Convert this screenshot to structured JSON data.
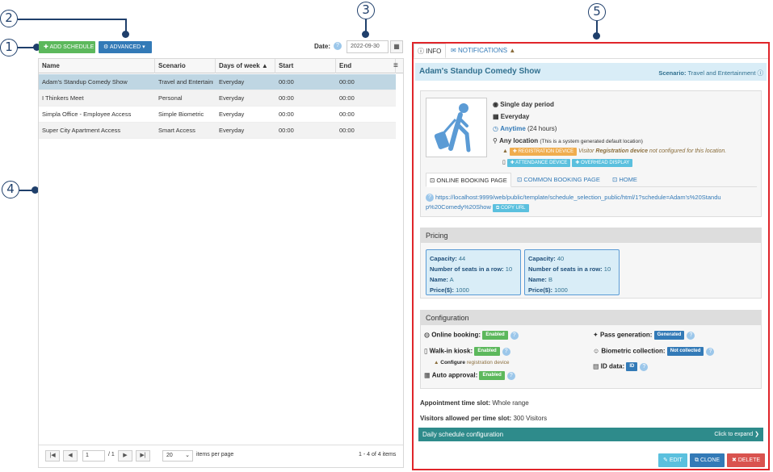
{
  "callouts": [
    "1",
    "2",
    "3",
    "4",
    "5"
  ],
  "toolbar": {
    "add_schedule": "ADD SCHEDULE",
    "advanced": "ADVANCED",
    "date_label": "Date:",
    "date_value": "2022-09-30"
  },
  "grid": {
    "columns": [
      "Name",
      "Scenario",
      "Days of week",
      "Start",
      "End"
    ],
    "rows": [
      {
        "name": "Adam's Standup Comedy Show",
        "scenario": "Travel and Entertainment",
        "days": "Everyday",
        "start": "00:00",
        "end": "00:00"
      },
      {
        "name": "I Thinkers Meet",
        "scenario": "Personal",
        "days": "Everyday",
        "start": "00:00",
        "end": "00:00"
      },
      {
        "name": "Simpla Office - Employee Access",
        "scenario": "Simple Biometric",
        "days": "Everyday",
        "start": "00:00",
        "end": "00:00"
      },
      {
        "name": "Super City Apartment Access",
        "scenario": "Smart Access",
        "days": "Everyday",
        "start": "00:00",
        "end": "00:00"
      }
    ],
    "page_current": "1",
    "page_total": "/ 1",
    "page_size": "20",
    "items_per_page": "items per page",
    "summary": "1 - 4 of 4 items"
  },
  "detail": {
    "tab_info": "INFO",
    "tab_notifications": "NOTIFICATIONS",
    "title": "Adam's Standup Comedy Show",
    "scenario_label": "Scenario:",
    "scenario_value": "Travel and Entertainment",
    "period": "Single day period",
    "days": "Everyday",
    "time": "Anytime",
    "time_note": "(24 hours)",
    "location": "Any location",
    "location_note": "(This is a system generated default location)",
    "reg_device_badge": "REGISTRATION DEVICE",
    "reg_warning_1": "Visitor",
    "reg_warning_bold": "Registration device",
    "reg_warning_2": "not configured for this location.",
    "attendance_badge": "ATTENDANCE DEVICE",
    "overhead_badge": "OVERHEAD DISPLAY",
    "link_tabs": [
      "ONLINE BOOKING PAGE",
      "COMMON BOOKING PAGE",
      "HOME"
    ],
    "url_line1": "https://localhost:9999/web/public/template/schedule_selection_public/html/1?schedule=Adam's%20Standu",
    "url_line2": "p%20Comedy%20Show",
    "copy_url": "COPY URL",
    "pricing_title": "Pricing",
    "pricing": [
      {
        "capacity": "44",
        "seats_row": "10",
        "name": "A",
        "price": "1000"
      },
      {
        "capacity": "40",
        "seats_row": "10",
        "name": "B",
        "price": "1000"
      }
    ],
    "pricing_labels": {
      "capacity": "Capacity:",
      "seats_row": "Number of seats in a row:",
      "name": "Name:",
      "price": "Price($):"
    },
    "config_title": "Configuration",
    "config": {
      "online_booking": "Online booking:",
      "online_booking_val": "Enabled",
      "walkin": "Walk-in kiosk:",
      "walkin_val": "Enabled",
      "configure_bold": "Configure",
      "configure_rest": "registration device",
      "auto_approval": "Auto approval:",
      "auto_approval_val": "Enabled",
      "pass_gen": "Pass generation:",
      "pass_gen_val": "Generated",
      "bio": "Biometric collection:",
      "bio_val": "Not collected",
      "id_data": "ID data:",
      "id_data_val": "ID"
    },
    "slot_label": "Appointment time slot:",
    "slot_value": "Whole range",
    "visitors_label": "Visitors allowed per time slot:",
    "visitors_value": "300 Visitors",
    "daily_bar": "Daily schedule configuration",
    "daily_expand": "Click to expand",
    "btn_edit": "EDIT",
    "btn_clone": "CLONE",
    "btn_delete": "DELETE"
  },
  "colors": {
    "accent": "#337ab7",
    "success": "#5cb85c",
    "warning": "#f0ad4e",
    "info": "#5bc0de",
    "danger": "#d9534f",
    "bar": "#2e8b8b",
    "highlight": "#e0252a"
  }
}
